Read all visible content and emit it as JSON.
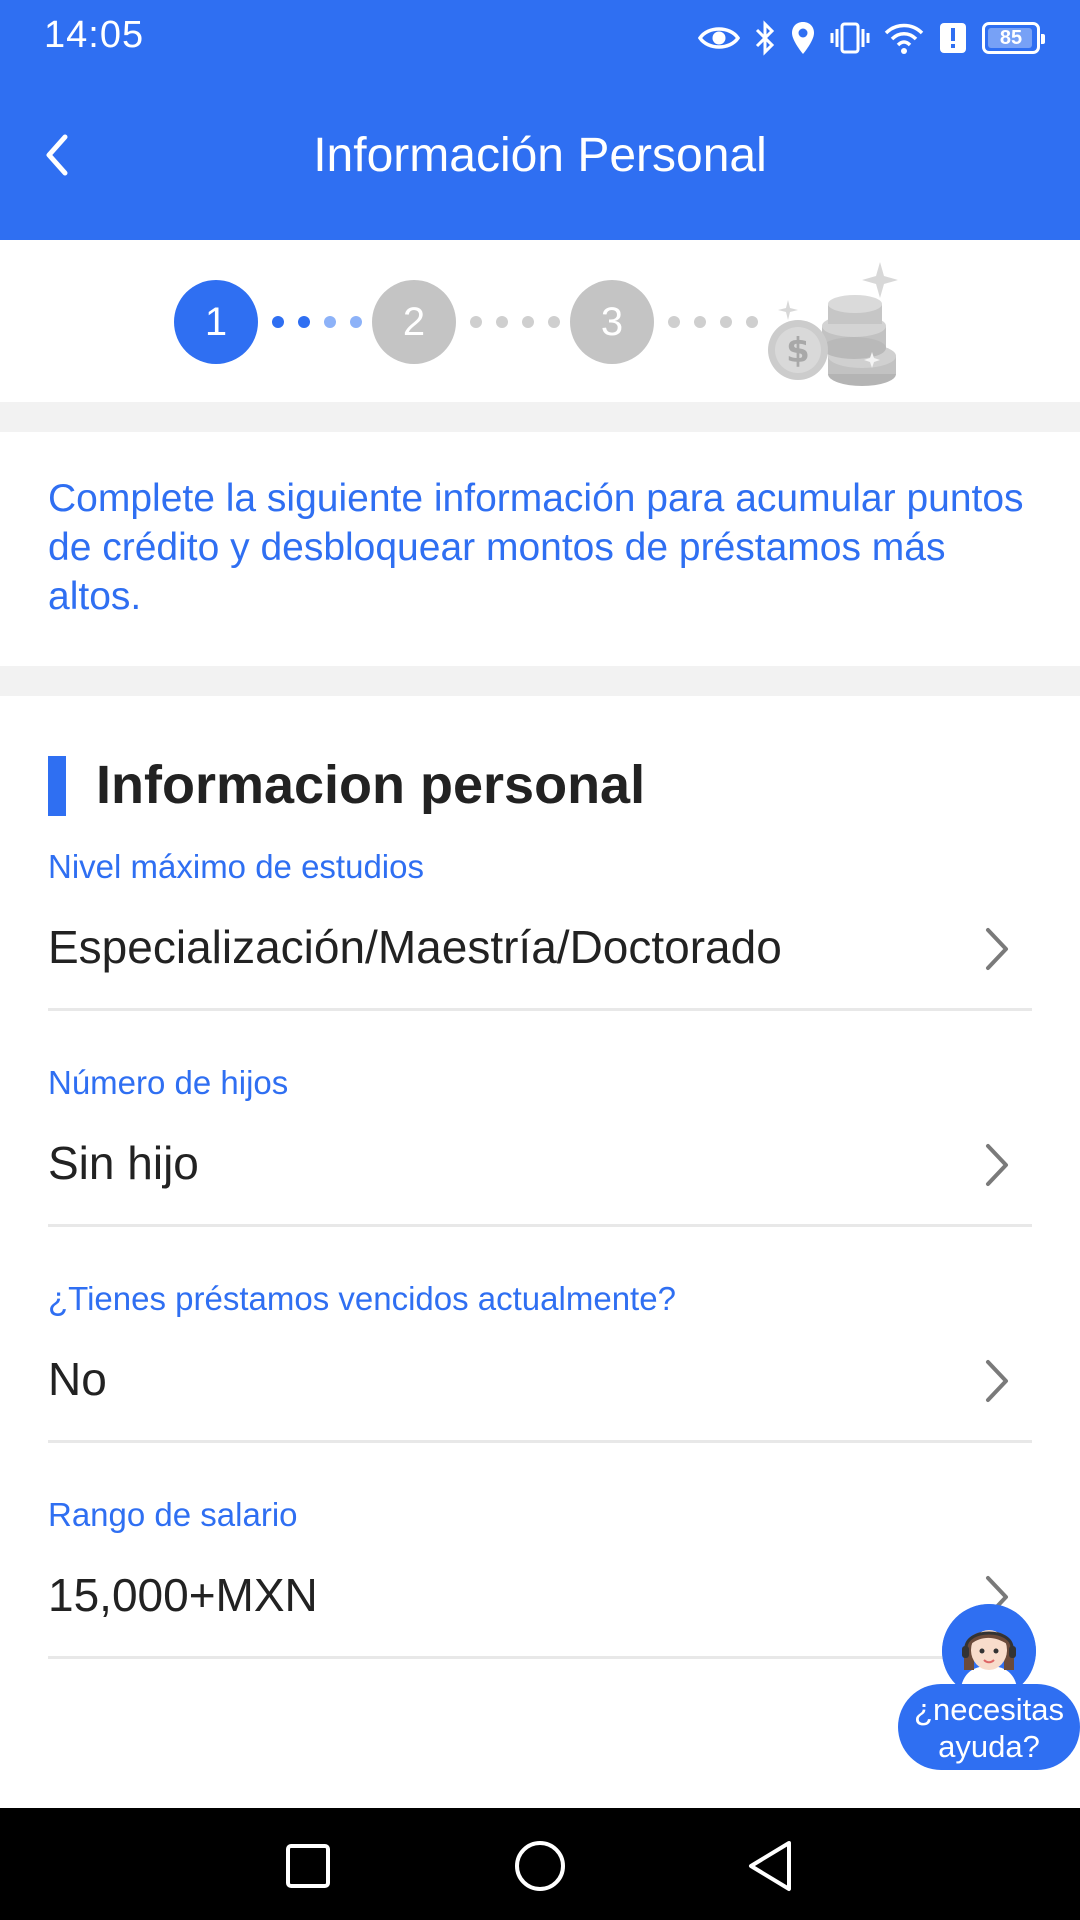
{
  "status_bar": {
    "time": "14:05",
    "battery": "85",
    "battery_level": 0.85,
    "icons": [
      "eye-icon",
      "bluetooth-icon",
      "location-icon",
      "vibrate-icon",
      "wifi-icon",
      "alert-icon",
      "battery-icon"
    ]
  },
  "header": {
    "title": "Información Personal",
    "back_icon": "chevron-left-icon",
    "background_color": "#2f6ff2"
  },
  "steps": {
    "items": [
      {
        "label": "1",
        "state": "active"
      },
      {
        "label": "2",
        "state": "inactive"
      },
      {
        "label": "3",
        "state": "inactive"
      }
    ],
    "final_icon": "coins-icon"
  },
  "intro": {
    "text": "Complete la siguiente información para acumular puntos de crédito y desbloquear montos de préstamos más altos."
  },
  "section": {
    "title": "Informacion personal"
  },
  "fields": [
    {
      "label": "Nivel máximo de estudios",
      "value": "Especialización/Maestría/Doctorado"
    },
    {
      "label": "Número de hijos",
      "value": "Sin hijo"
    },
    {
      "label": "¿Tienes préstamos vencidos actualmente?",
      "value": "No"
    },
    {
      "label": "Rango de salario",
      "value": "15,000+MXN"
    }
  ],
  "help": {
    "label": "¿necesitas ayuda?"
  },
  "nav": {
    "icons": [
      "recent-apps-icon",
      "home-icon",
      "back-icon"
    ]
  }
}
